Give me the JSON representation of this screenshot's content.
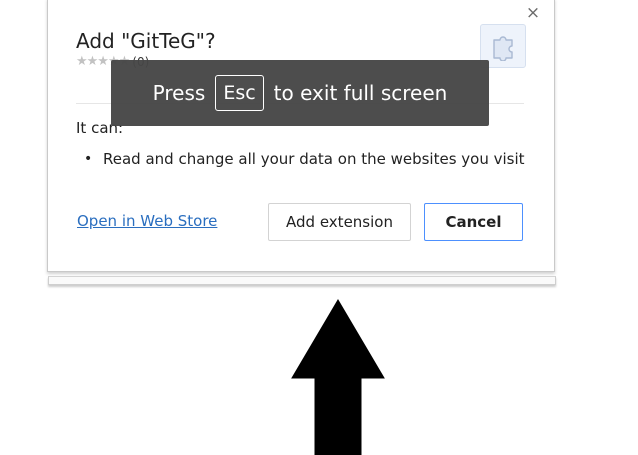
{
  "dialog": {
    "title": "Add \"GitTeG\"?",
    "close_label": "×",
    "rating": {
      "stars_text": "★★★★★",
      "count_text": "(0)"
    },
    "extension_icon": "puzzle-piece-icon",
    "permissions_heading": "It can:",
    "permissions": [
      "Read and change all your data on the websites you visit"
    ],
    "store_link": "Open in Web Store",
    "add_button": "Add extension",
    "cancel_button": "Cancel"
  },
  "toast": {
    "prefix": "Press",
    "key": "Esc",
    "suffix": "to exit full screen"
  },
  "annotation": {
    "arrow_icon": "up-arrow-icon"
  },
  "colors": {
    "link": "#2a6ebf",
    "cancel_border": "#4d90fe",
    "toast_bg": "#464646",
    "icon_bg": "#eef3fb"
  }
}
